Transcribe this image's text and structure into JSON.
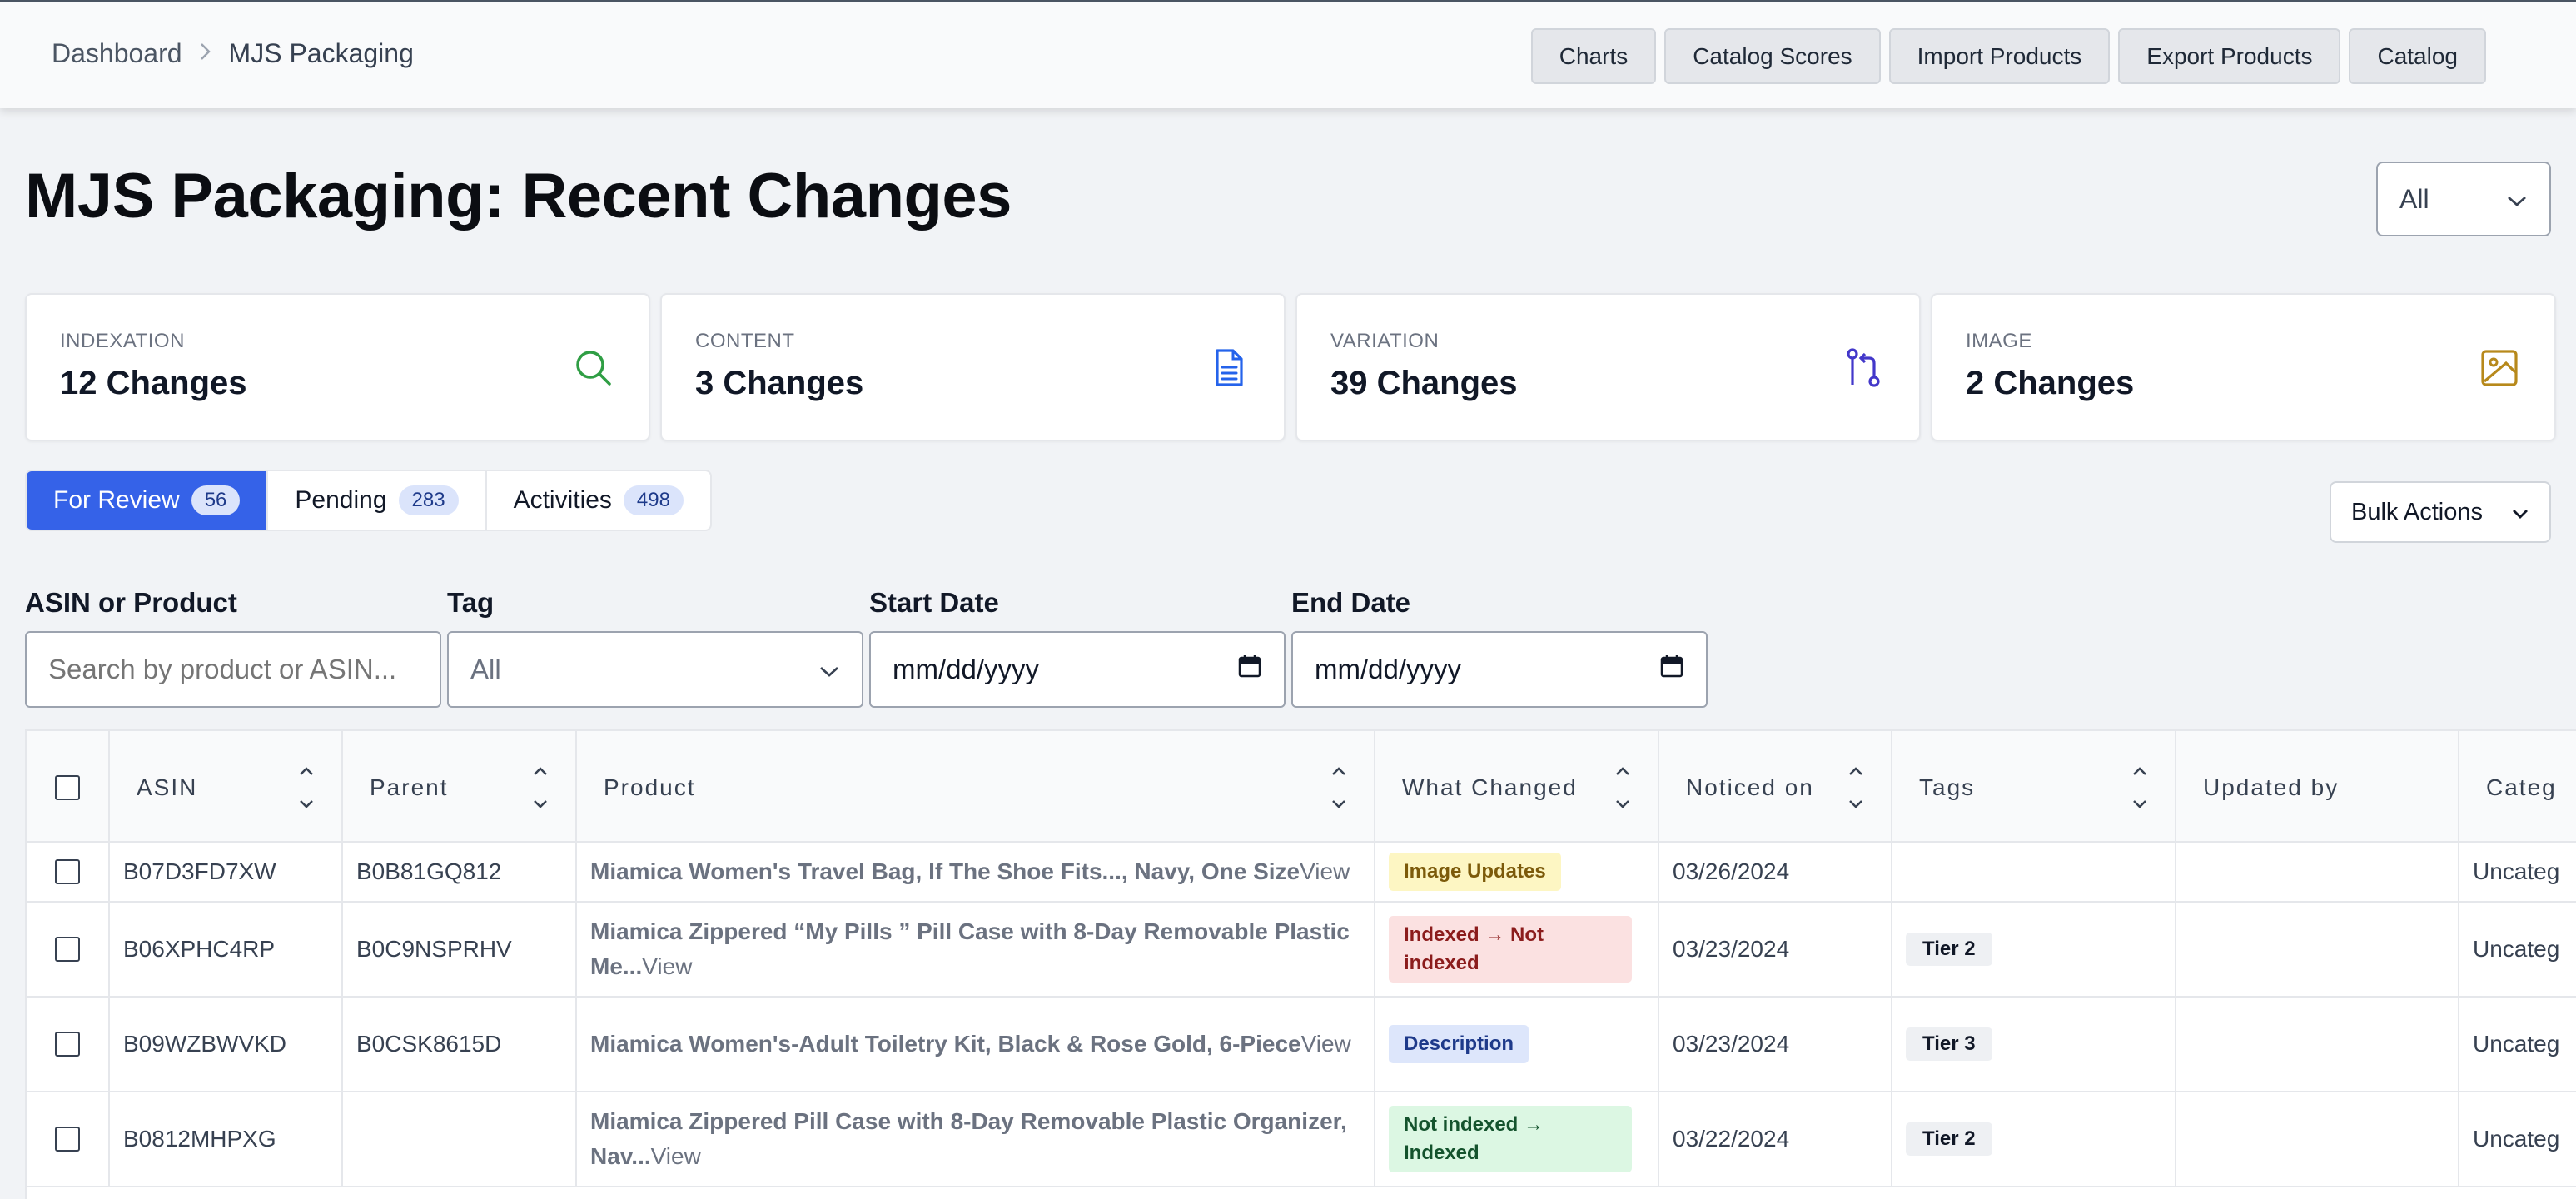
{
  "breadcrumb": {
    "root": "Dashboard",
    "current": "MJS Packaging"
  },
  "topnav": [
    "Charts",
    "Catalog Scores",
    "Import Products",
    "Export Products",
    "Catalog"
  ],
  "page_title": "MJS Packaging: Recent Changes",
  "top_filter": {
    "value": "All"
  },
  "cards": [
    {
      "label": "INDEXATION",
      "value": "12 Changes",
      "icon": "search-icon",
      "color": "#2f9e44"
    },
    {
      "label": "CONTENT",
      "value": "3 Changes",
      "icon": "document-icon",
      "color": "#2563eb"
    },
    {
      "label": "VARIATION",
      "value": "39 Changes",
      "icon": "git-pull-request-icon",
      "color": "#4338ca"
    },
    {
      "label": "IMAGE",
      "value": "2 Changes",
      "icon": "image-icon",
      "color": "#b7891b"
    }
  ],
  "tabs": [
    {
      "label": "For Review",
      "count": "56",
      "active": true
    },
    {
      "label": "Pending",
      "count": "283",
      "active": false
    },
    {
      "label": "Activities",
      "count": "498",
      "active": false
    }
  ],
  "bulk_actions": "Bulk Actions",
  "filters": {
    "asin": {
      "label": "ASIN or Product",
      "placeholder": "Search by product or ASIN..."
    },
    "tag": {
      "label": "Tag",
      "value": "All"
    },
    "start": {
      "label": "Start Date",
      "value": "mm/dd/yyyy"
    },
    "end": {
      "label": "End Date",
      "value": "mm/dd/yyyy"
    }
  },
  "table": {
    "columns": [
      "ASIN",
      "Parent",
      "Product",
      "What Changed",
      "Noticed on",
      "Tags",
      "Updated by",
      "Categ"
    ],
    "rows": [
      {
        "asin": "B07D3FD7XW",
        "parent": "B0B81GQ812",
        "product": "Miamica Women's Travel Bag, If The Shoe Fits..., Navy, One Size",
        "view": "View",
        "change": "Image Updates",
        "change_type": "image",
        "noticed": "03/26/2024",
        "tag": "",
        "updated_by": "",
        "category": "Uncateg"
      },
      {
        "asin": "B06XPHC4RP",
        "parent": "B0C9NSPRHV",
        "product": "Miamica Zippered “My Pills ” Pill Case with 8-Day Removable Plastic Me...",
        "view": "View",
        "change": "Indexed → Not indexed",
        "change_type": "not-indexed",
        "noticed": "03/23/2024",
        "tag": "Tier 2",
        "updated_by": "",
        "category": "Uncateg"
      },
      {
        "asin": "B09WZBWVKD",
        "parent": "B0CSK8615D",
        "product": "Miamica Women's-Adult Toiletry Kit, Black & Rose Gold, 6-Piece",
        "view": "View",
        "change": "Description",
        "change_type": "description",
        "noticed": "03/23/2024",
        "tag": "Tier 3",
        "updated_by": "",
        "category": "Uncateg"
      },
      {
        "asin": "B0812MHPXG",
        "parent": "",
        "product": "Miamica Zippered Pill Case with 8-Day Removable Plastic Organizer, Nav...",
        "view": "View",
        "change": "Not indexed → Indexed",
        "change_type": "indexed",
        "noticed": "03/22/2024",
        "tag": "Tier 2",
        "updated_by": "",
        "category": "Uncateg"
      }
    ]
  }
}
